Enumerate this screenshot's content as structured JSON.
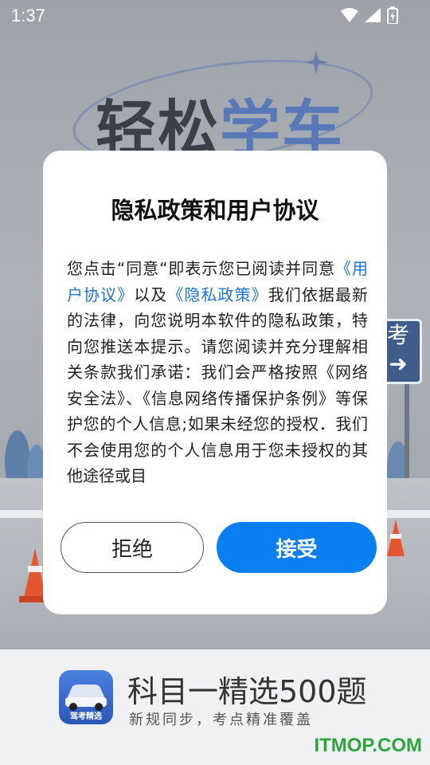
{
  "status_bar": {
    "time": "1:37",
    "icons": [
      "wifi-icon",
      "cellular-signal-icon",
      "battery-charging-icon"
    ]
  },
  "splash": {
    "brand_part1": "轻松",
    "brand_part2": "学车",
    "sign_text": "考"
  },
  "dialog": {
    "title": "隐私政策和用户协议",
    "body": [
      {
        "text": "您点击“同意“即表示您已阅读并同意",
        "link": false
      },
      {
        "text": "《用户协议》",
        "link": true
      },
      {
        "text": "以及",
        "link": false
      },
      {
        "text": "《隐私政策》",
        "link": true
      },
      {
        "text": "我们依据最新的法律，向您说明本软件的隐私政策，特向您推送本提示。请您阅读并充分理解相关条款我们承诺：我们会严格按照《网络安全法》、《信息网络传播保护条例》等保护您的个人信息;如果未经您的授权．我们不会使用您的个人信息用于您未授权的其他途径或目",
        "link": false
      }
    ],
    "reject_label": "拒绝",
    "accept_label": "接受"
  },
  "banner": {
    "icon_label": "驾考精选",
    "title": "科目一精选500题",
    "subtitle": "新规同步，考点精准覆盖"
  },
  "watermark": "ITMOP.COM",
  "colors": {
    "accent": "#0a7ff2",
    "link": "#1a73d9",
    "watermark": "#2ea43e"
  }
}
